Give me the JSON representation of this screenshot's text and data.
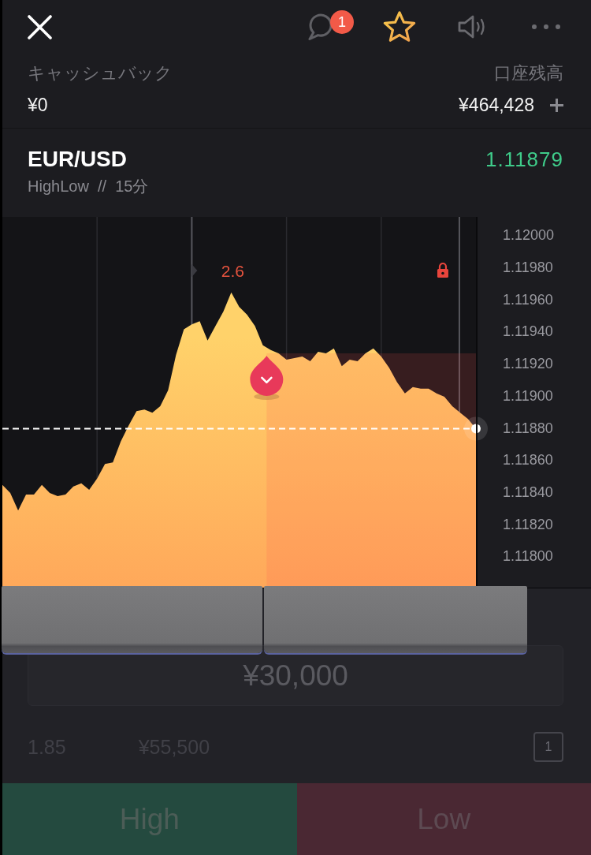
{
  "header": {
    "notification_badge": "1"
  },
  "balances": {
    "cashback_label": "キャッシュバック",
    "cashback": "¥0",
    "balance_label": "口座残高",
    "balance": "¥464,428"
  },
  "instrument": {
    "symbol": "EUR/USD",
    "price": "1.11879",
    "subtitle": "HighLow  //  15分"
  },
  "chart": {
    "positions": [
      {
        "kind": "low"
      }
    ],
    "chart_data": {
      "type": "area",
      "values": [
        1.11844,
        1.11839,
        1.11828,
        1.11838,
        1.11838,
        1.11844,
        1.11839,
        1.11837,
        1.11838,
        1.11843,
        1.11845,
        1.11841,
        1.11848,
        1.11857,
        1.11858,
        1.11871,
        1.11881,
        1.1189,
        1.11891,
        1.11889,
        1.11893,
        1.11903,
        1.11925,
        1.11941,
        1.11944,
        1.11946,
        1.11934,
        1.11943,
        1.11952,
        1.11964,
        1.11955,
        1.1195,
        1.11943,
        1.11931,
        1.11928,
        1.11926,
        1.11922,
        1.11923,
        1.11924,
        1.11921,
        1.11927,
        1.11926,
        1.11929,
        1.11918,
        1.11922,
        1.11921,
        1.11926,
        1.11929,
        1.11924,
        1.11917,
        1.11908,
        1.11901,
        1.11905,
        1.11904,
        1.11904,
        1.11901,
        1.11899,
        1.11893,
        1.11889,
        1.11885,
        1.11879
      ],
      "ylim": [
        1.1178,
        1.12011
      ],
      "yticks": [
        {
          "value": 1.12,
          "label": "1.12000"
        },
        {
          "value": 1.1198,
          "label": "1.11980"
        },
        {
          "value": 1.1196,
          "label": "1.11960"
        },
        {
          "value": 1.1194,
          "label": "1.11940"
        },
        {
          "value": 1.1192,
          "label": "1.11920"
        },
        {
          "value": 1.119,
          "label": "1.11900"
        },
        {
          "value": 1.1188,
          "label": "1.11880"
        },
        {
          "value": 1.1186,
          "label": "1.11860"
        },
        {
          "value": 1.1184,
          "label": "1.11840"
        },
        {
          "value": 1.1182,
          "label": "1.11820"
        },
        {
          "value": 1.118,
          "label": "1.11800"
        }
      ],
      "grid": true,
      "ref_lines": [
        {
          "axis": "y",
          "value": 1.11879
        }
      ],
      "bands": [
        {
          "axis": "y",
          "from": 1.1178,
          "to": 1.11926
        }
      ],
      "annotations": [
        "2.6"
      ]
    }
  },
  "trade": {
    "amount": "¥30,000",
    "payout_rate": "1.85",
    "payout": "¥55,500",
    "one_click_label": "1",
    "buttons": [
      {
        "kind": "high",
        "label": "High"
      },
      {
        "kind": "low",
        "label": "Low"
      }
    ]
  }
}
